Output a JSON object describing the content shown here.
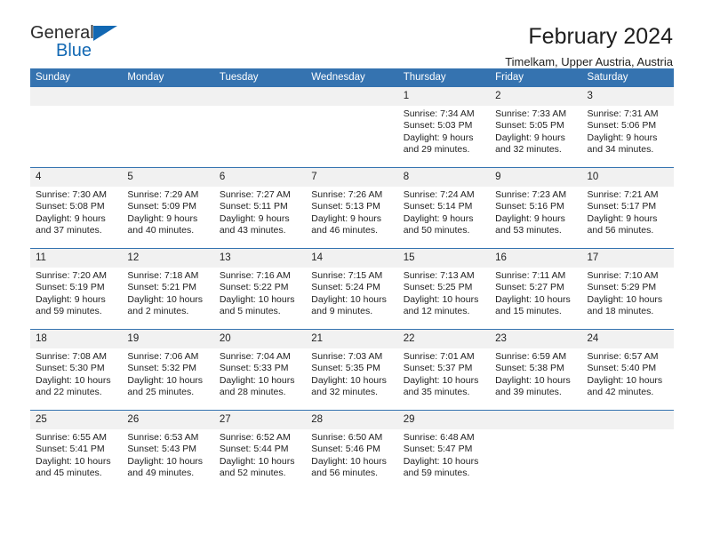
{
  "brand": {
    "word_one": "General",
    "word_two": "Blue",
    "triangle_color": "#1268b3",
    "icon": "blue-triangle-icon"
  },
  "header": {
    "title": "February 2024",
    "subtitle": "Timelkam, Upper Austria, Austria"
  },
  "calendar": {
    "accent_color": "#3573b0",
    "daynum_band_color": "#f1f1f1",
    "weekday_headers": [
      "Sunday",
      "Monday",
      "Tuesday",
      "Wednesday",
      "Thursday",
      "Friday",
      "Saturday"
    ],
    "weeks": [
      [
        {
          "day": "",
          "lines": []
        },
        {
          "day": "",
          "lines": []
        },
        {
          "day": "",
          "lines": []
        },
        {
          "day": "",
          "lines": []
        },
        {
          "day": "1",
          "lines": [
            "Sunrise: 7:34 AM",
            "Sunset: 5:03 PM",
            "Daylight: 9 hours",
            "and 29 minutes."
          ]
        },
        {
          "day": "2",
          "lines": [
            "Sunrise: 7:33 AM",
            "Sunset: 5:05 PM",
            "Daylight: 9 hours",
            "and 32 minutes."
          ]
        },
        {
          "day": "3",
          "lines": [
            "Sunrise: 7:31 AM",
            "Sunset: 5:06 PM",
            "Daylight: 9 hours",
            "and 34 minutes."
          ]
        }
      ],
      [
        {
          "day": "4",
          "lines": [
            "Sunrise: 7:30 AM",
            "Sunset: 5:08 PM",
            "Daylight: 9 hours",
            "and 37 minutes."
          ]
        },
        {
          "day": "5",
          "lines": [
            "Sunrise: 7:29 AM",
            "Sunset: 5:09 PM",
            "Daylight: 9 hours",
            "and 40 minutes."
          ]
        },
        {
          "day": "6",
          "lines": [
            "Sunrise: 7:27 AM",
            "Sunset: 5:11 PM",
            "Daylight: 9 hours",
            "and 43 minutes."
          ]
        },
        {
          "day": "7",
          "lines": [
            "Sunrise: 7:26 AM",
            "Sunset: 5:13 PM",
            "Daylight: 9 hours",
            "and 46 minutes."
          ]
        },
        {
          "day": "8",
          "lines": [
            "Sunrise: 7:24 AM",
            "Sunset: 5:14 PM",
            "Daylight: 9 hours",
            "and 50 minutes."
          ]
        },
        {
          "day": "9",
          "lines": [
            "Sunrise: 7:23 AM",
            "Sunset: 5:16 PM",
            "Daylight: 9 hours",
            "and 53 minutes."
          ]
        },
        {
          "day": "10",
          "lines": [
            "Sunrise: 7:21 AM",
            "Sunset: 5:17 PM",
            "Daylight: 9 hours",
            "and 56 minutes."
          ]
        }
      ],
      [
        {
          "day": "11",
          "lines": [
            "Sunrise: 7:20 AM",
            "Sunset: 5:19 PM",
            "Daylight: 9 hours",
            "and 59 minutes."
          ]
        },
        {
          "day": "12",
          "lines": [
            "Sunrise: 7:18 AM",
            "Sunset: 5:21 PM",
            "Daylight: 10 hours",
            "and 2 minutes."
          ]
        },
        {
          "day": "13",
          "lines": [
            "Sunrise: 7:16 AM",
            "Sunset: 5:22 PM",
            "Daylight: 10 hours",
            "and 5 minutes."
          ]
        },
        {
          "day": "14",
          "lines": [
            "Sunrise: 7:15 AM",
            "Sunset: 5:24 PM",
            "Daylight: 10 hours",
            "and 9 minutes."
          ]
        },
        {
          "day": "15",
          "lines": [
            "Sunrise: 7:13 AM",
            "Sunset: 5:25 PM",
            "Daylight: 10 hours",
            "and 12 minutes."
          ]
        },
        {
          "day": "16",
          "lines": [
            "Sunrise: 7:11 AM",
            "Sunset: 5:27 PM",
            "Daylight: 10 hours",
            "and 15 minutes."
          ]
        },
        {
          "day": "17",
          "lines": [
            "Sunrise: 7:10 AM",
            "Sunset: 5:29 PM",
            "Daylight: 10 hours",
            "and 18 minutes."
          ]
        }
      ],
      [
        {
          "day": "18",
          "lines": [
            "Sunrise: 7:08 AM",
            "Sunset: 5:30 PM",
            "Daylight: 10 hours",
            "and 22 minutes."
          ]
        },
        {
          "day": "19",
          "lines": [
            "Sunrise: 7:06 AM",
            "Sunset: 5:32 PM",
            "Daylight: 10 hours",
            "and 25 minutes."
          ]
        },
        {
          "day": "20",
          "lines": [
            "Sunrise: 7:04 AM",
            "Sunset: 5:33 PM",
            "Daylight: 10 hours",
            "and 28 minutes."
          ]
        },
        {
          "day": "21",
          "lines": [
            "Sunrise: 7:03 AM",
            "Sunset: 5:35 PM",
            "Daylight: 10 hours",
            "and 32 minutes."
          ]
        },
        {
          "day": "22",
          "lines": [
            "Sunrise: 7:01 AM",
            "Sunset: 5:37 PM",
            "Daylight: 10 hours",
            "and 35 minutes."
          ]
        },
        {
          "day": "23",
          "lines": [
            "Sunrise: 6:59 AM",
            "Sunset: 5:38 PM",
            "Daylight: 10 hours",
            "and 39 minutes."
          ]
        },
        {
          "day": "24",
          "lines": [
            "Sunrise: 6:57 AM",
            "Sunset: 5:40 PM",
            "Daylight: 10 hours",
            "and 42 minutes."
          ]
        }
      ],
      [
        {
          "day": "25",
          "lines": [
            "Sunrise: 6:55 AM",
            "Sunset: 5:41 PM",
            "Daylight: 10 hours",
            "and 45 minutes."
          ]
        },
        {
          "day": "26",
          "lines": [
            "Sunrise: 6:53 AM",
            "Sunset: 5:43 PM",
            "Daylight: 10 hours",
            "and 49 minutes."
          ]
        },
        {
          "day": "27",
          "lines": [
            "Sunrise: 6:52 AM",
            "Sunset: 5:44 PM",
            "Daylight: 10 hours",
            "and 52 minutes."
          ]
        },
        {
          "day": "28",
          "lines": [
            "Sunrise: 6:50 AM",
            "Sunset: 5:46 PM",
            "Daylight: 10 hours",
            "and 56 minutes."
          ]
        },
        {
          "day": "29",
          "lines": [
            "Sunrise: 6:48 AM",
            "Sunset: 5:47 PM",
            "Daylight: 10 hours",
            "and 59 minutes."
          ]
        },
        {
          "day": "",
          "lines": []
        },
        {
          "day": "",
          "lines": []
        }
      ]
    ]
  }
}
